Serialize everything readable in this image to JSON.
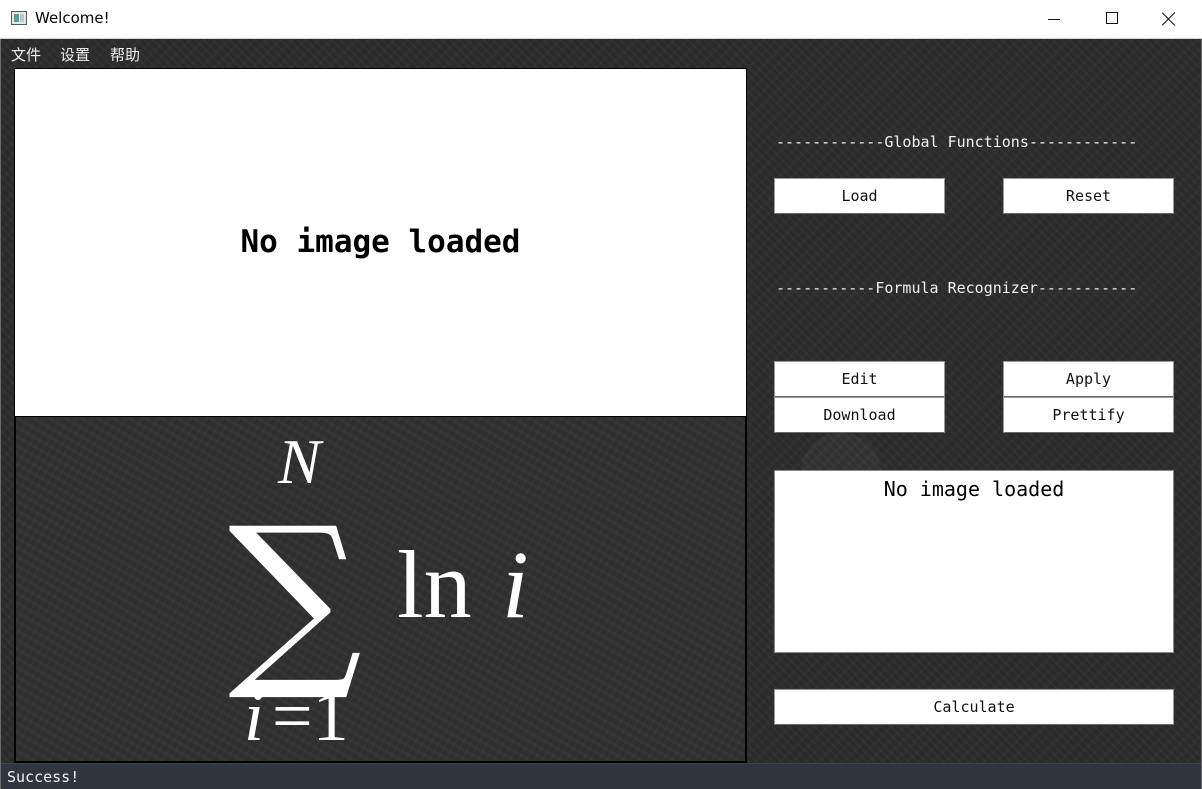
{
  "window": {
    "title": "Welcome!"
  },
  "menu": {
    "file": "文件",
    "settings": "设置",
    "help": "帮助"
  },
  "preview": {
    "placeholder": "No image loaded"
  },
  "formula_display": {
    "upper_limit": "N",
    "operator": "∑",
    "function": "ln",
    "variable": "i",
    "lower_limit_var": "i",
    "lower_limit_eq": "=1"
  },
  "global_functions": {
    "heading": "------------Global Functions------------",
    "load_label": "Load",
    "reset_label": "Reset"
  },
  "formula_recognizer": {
    "heading": "-----------Formula Recognizer-----------",
    "edit_label": "Edit",
    "apply_label": "Apply",
    "download_label": "Download",
    "prettify_label": "Prettify"
  },
  "result": {
    "text": "No image loaded"
  },
  "calculate_label": "Calculate",
  "status": {
    "text": "Success!"
  }
}
